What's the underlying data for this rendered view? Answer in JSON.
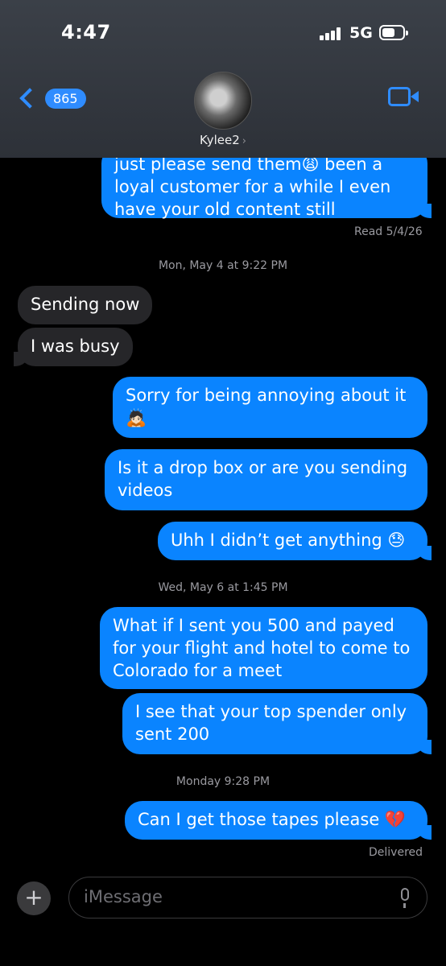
{
  "status": {
    "time": "4:47",
    "network": "5G"
  },
  "header": {
    "back_count": "865",
    "contact_name": "Kylee2",
    "contact_chevron": "›"
  },
  "messages": [
    {
      "type": "out",
      "text": "just please send them😩 been a\nloyal customer for a while I even\nhave your old content still"
    },
    {
      "type": "meta",
      "text": "Read 5/4/26"
    },
    {
      "type": "date",
      "text": "Mon, May 4 at 9:22 PM"
    },
    {
      "type": "in",
      "text": "Sending now"
    },
    {
      "type": "in",
      "text": "I was busy"
    },
    {
      "type": "out",
      "text": "Sorry for being annoying about it\n🙇🏻"
    },
    {
      "type": "out",
      "text": "Is it a drop box or are you sending\nvideos"
    },
    {
      "type": "out",
      "text": "Uhh I didn’t get anything 😓"
    },
    {
      "type": "date",
      "text": "Wed, May 6 at 1:45 PM"
    },
    {
      "type": "out",
      "text": "What if I sent you 500 and payed\nfor your flight and hotel to come to\nColorado for a meet"
    },
    {
      "type": "out",
      "text": "I see that your top spender only\nsent 200"
    },
    {
      "type": "date",
      "text": "Monday 9:28 PM"
    },
    {
      "type": "out",
      "text": "Can I get those tapes please 💔"
    },
    {
      "type": "meta",
      "text": "Delivered"
    }
  ],
  "composer": {
    "placeholder": "iMessage",
    "add_label": "+"
  },
  "colors": {
    "accent": "#0a84ff",
    "incoming": "#262629",
    "background": "#000000"
  }
}
